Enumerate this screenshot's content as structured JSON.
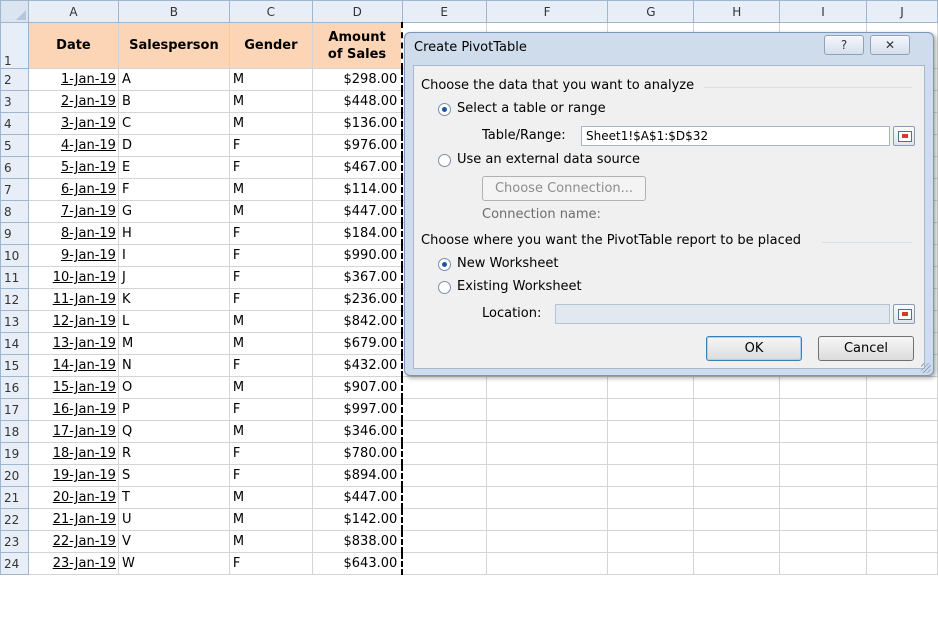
{
  "columns": [
    "A",
    "B",
    "C",
    "D",
    "E",
    "F",
    "G",
    "H",
    "I",
    "J"
  ],
  "headers": {
    "date": "Date",
    "salesperson": "Salesperson",
    "gender": "Gender",
    "amount_line1": "Amount",
    "amount_line2": "of Sales"
  },
  "rows": [
    {
      "n": "2",
      "date": "1-Jan-19",
      "sp": "A",
      "g": "M",
      "amt": "$298.00"
    },
    {
      "n": "3",
      "date": "2-Jan-19",
      "sp": "B",
      "g": "M",
      "amt": "$448.00"
    },
    {
      "n": "4",
      "date": "3-Jan-19",
      "sp": "C",
      "g": "M",
      "amt": "$136.00"
    },
    {
      "n": "5",
      "date": "4-Jan-19",
      "sp": "D",
      "g": "F",
      "amt": "$976.00"
    },
    {
      "n": "6",
      "date": "5-Jan-19",
      "sp": "E",
      "g": "F",
      "amt": "$467.00"
    },
    {
      "n": "7",
      "date": "6-Jan-19",
      "sp": "F",
      "g": "M",
      "amt": "$114.00"
    },
    {
      "n": "8",
      "date": "7-Jan-19",
      "sp": "G",
      "g": "M",
      "amt": "$447.00"
    },
    {
      "n": "9",
      "date": "8-Jan-19",
      "sp": "H",
      "g": "F",
      "amt": "$184.00"
    },
    {
      "n": "10",
      "date": "9-Jan-19",
      "sp": "I",
      "g": "F",
      "amt": "$990.00"
    },
    {
      "n": "11",
      "date": "10-Jan-19",
      "sp": "J",
      "g": "F",
      "amt": "$367.00"
    },
    {
      "n": "12",
      "date": "11-Jan-19",
      "sp": "K",
      "g": "F",
      "amt": "$236.00"
    },
    {
      "n": "13",
      "date": "12-Jan-19",
      "sp": "L",
      "g": "M",
      "amt": "$842.00"
    },
    {
      "n": "14",
      "date": "13-Jan-19",
      "sp": "M",
      "g": "M",
      "amt": "$679.00"
    },
    {
      "n": "15",
      "date": "14-Jan-19",
      "sp": "N",
      "g": "F",
      "amt": "$432.00"
    },
    {
      "n": "16",
      "date": "15-Jan-19",
      "sp": "O",
      "g": "M",
      "amt": "$907.00"
    },
    {
      "n": "17",
      "date": "16-Jan-19",
      "sp": "P",
      "g": "F",
      "amt": "$997.00"
    },
    {
      "n": "18",
      "date": "17-Jan-19",
      "sp": "Q",
      "g": "M",
      "amt": "$346.00"
    },
    {
      "n": "19",
      "date": "18-Jan-19",
      "sp": "R",
      "g": "F",
      "amt": "$780.00"
    },
    {
      "n": "20",
      "date": "19-Jan-19",
      "sp": "S",
      "g": "F",
      "amt": "$894.00"
    },
    {
      "n": "21",
      "date": "20-Jan-19",
      "sp": "T",
      "g": "M",
      "amt": "$447.00"
    },
    {
      "n": "22",
      "date": "21-Jan-19",
      "sp": "U",
      "g": "M",
      "amt": "$142.00"
    },
    {
      "n": "23",
      "date": "22-Jan-19",
      "sp": "V",
      "g": "M",
      "amt": "$838.00"
    },
    {
      "n": "24",
      "date": "23-Jan-19",
      "sp": "W",
      "g": "F",
      "amt": "$643.00"
    }
  ],
  "dialog": {
    "title": "Create PivotTable",
    "help_glyph": "?",
    "close_glyph": "✕",
    "section1": "Choose the data that you want to analyze",
    "opt_select_range": "Select a table or range",
    "table_range_label": "Table/Range:",
    "table_range_value": "Sheet1!$A$1:$D$32",
    "opt_external": "Use an external data source",
    "choose_connection": "Choose Connection...",
    "connection_name": "Connection name:",
    "section2": "Choose where you want the PivotTable report to be placed",
    "opt_new_ws": "New Worksheet",
    "opt_existing_ws": "Existing Worksheet",
    "location_label": "Location:",
    "location_value": "",
    "ok": "OK",
    "cancel": "Cancel"
  },
  "colors": {
    "header_fill": "#fbd5b5",
    "dialog_bg": "#cfdcec",
    "accent": "#1b54a8"
  }
}
